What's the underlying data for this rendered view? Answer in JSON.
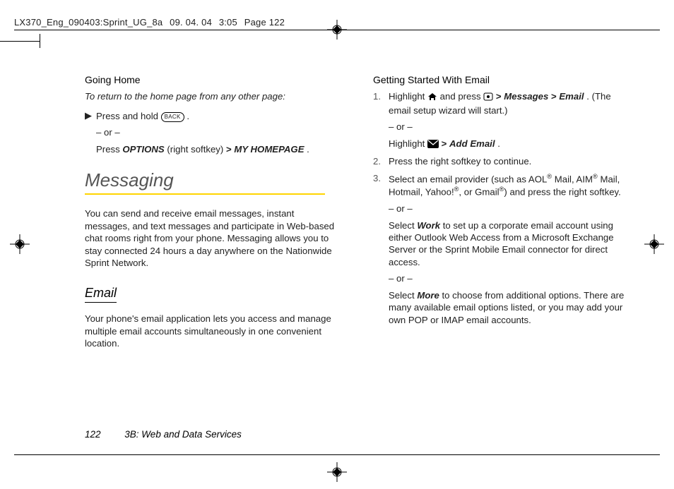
{
  "header": {
    "job": "LX370_Eng_090403:Sprint_UG_8a",
    "date": "09. 04. 04",
    "time": "3:05",
    "page": "Page 122"
  },
  "left": {
    "goingHome": {
      "title": "Going Home",
      "intro": "To return to the home page from any other page:",
      "step1_pre": "Press and hold ",
      "back_label": "BACK",
      "step1_post": ".",
      "or": "– or –",
      "step2_pre": "Press ",
      "step2_b1": "OPTIONS",
      "step2_mid": " (right softkey) ",
      "step2_b2": "MY HOMEPAGE",
      "step2_post": "."
    },
    "messagingTitle": "Messaging",
    "messagingPara": "You can send and receive email messages, instant messages, and text messages and participate in Web-based chat rooms right from your phone. Messaging allows you to stay connected 24 hours a day anywhere on the Nationwide Sprint Network.",
    "emailTitle": "Email",
    "emailPara": "Your phone's email application lets you access and manage multiple email accounts simultaneously in one convenient location."
  },
  "right": {
    "title": "Getting Started With Email",
    "s1": {
      "pre": "Highlight ",
      "mid1": " and press ",
      "m1": "Messages",
      "m2": "Email",
      "post": ". (The email setup wizard will start.)",
      "or": "– or –",
      "alt_pre": "Highlight ",
      "alt_b": "Add Email",
      "alt_post": "."
    },
    "s2": "Press the right softkey to continue.",
    "s3": {
      "line1": "Select an email provider (such as AOL® Mail, AIM® Mail, Hotmail, Yahoo!®, or Gmail®) and press the right softkey.",
      "or": "– or –",
      "work_pre": "Select ",
      "work_b": "Work",
      "work_post": " to set up a corporate email account using either Outlook Web Access from a Microsoft Exchange Server or the Sprint Mobile Email connector for direct access.",
      "more_pre": "Select ",
      "more_b": "More",
      "more_post": " to choose from additional options. There are many available email options listed, or you may add your own POP or IMAP email accounts."
    }
  },
  "footer": {
    "pageNum": "122",
    "section": "3B: Web and Data Services"
  }
}
